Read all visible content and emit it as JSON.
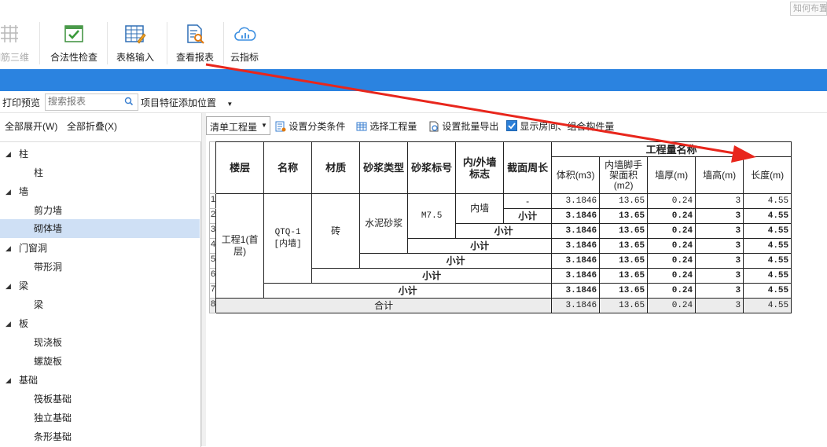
{
  "help_text": "知何布置",
  "ribbon": [
    {
      "label": "钢筋三维",
      "icon": "rebar-3d-icon",
      "disabled": true
    },
    {
      "label": "合法性检查",
      "icon": "check-icon"
    },
    {
      "label": "表格输入",
      "icon": "table-input-icon"
    },
    {
      "label": "查看报表",
      "icon": "report-search-icon"
    },
    {
      "label": "云指标",
      "icon": "cloud-chart-icon"
    }
  ],
  "toolbar": {
    "print_preview": "打印预览",
    "search_placeholder": "搜索报表",
    "feature_position": "项目特征添加位置"
  },
  "left": {
    "expand_all": "全部展开(W)",
    "collapse_all": "全部折叠(X)",
    "tree": [
      {
        "label": "柱",
        "level": 0
      },
      {
        "label": "柱",
        "level": 1
      },
      {
        "label": "墙",
        "level": 0
      },
      {
        "label": "剪力墙",
        "level": 1
      },
      {
        "label": "砌体墙",
        "level": 1,
        "selected": true
      },
      {
        "label": "门窗洞",
        "level": 0
      },
      {
        "label": "带形洞",
        "level": 1
      },
      {
        "label": "梁",
        "level": 0
      },
      {
        "label": "梁",
        "level": 1
      },
      {
        "label": "板",
        "level": 0
      },
      {
        "label": "现浇板",
        "level": 1
      },
      {
        "label": "螺旋板",
        "level": 1
      },
      {
        "label": "基础",
        "level": 0
      },
      {
        "label": "筏板基础",
        "level": 1
      },
      {
        "label": "独立基础",
        "level": 1
      },
      {
        "label": "条形基础",
        "level": 1
      }
    ]
  },
  "right_toolbar": {
    "quantity_type": "清单工程量",
    "set_category": "设置分类条件",
    "select_quantity": "选择工程量",
    "batch_export": "设置批量导出",
    "show_room": "显示房间、组合构件量",
    "show_room_checked": true
  },
  "table": {
    "headers": {
      "floor": "楼层",
      "name": "名称",
      "material": "材质",
      "mortar_type": "砂浆类型",
      "mortar_grade": "砂浆标号",
      "wall_side": "内/外墙标志",
      "perimeter": "截面周长",
      "group": "工程量名称",
      "volume": "体积(m3)",
      "scaffold": "内墙脚手架面积(m2)",
      "thickness": "墙厚(m)",
      "height": "墙高(m)",
      "length": "长度(m)"
    },
    "row_numbers": [
      "1",
      "2",
      "3",
      "4",
      "5",
      "6",
      "7",
      "8"
    ],
    "floor": "工程1(首层)",
    "name": "QTQ-1 [内墙]",
    "material": "砖",
    "mortar_type": "水泥砂浆",
    "mortar_grade": "M7.5",
    "wall_side": "内墙",
    "perimeter": "-",
    "subtotal_label": "小计",
    "total_label": "合计",
    "values": {
      "volume": "3.1846",
      "scaffold": "13.65",
      "thickness": "0.24",
      "height": "3",
      "length": "4.55"
    }
  },
  "colors": {
    "accent_bar": "#2b83e0",
    "arrow": "#e8261c",
    "selected": "#cfe0f5"
  }
}
